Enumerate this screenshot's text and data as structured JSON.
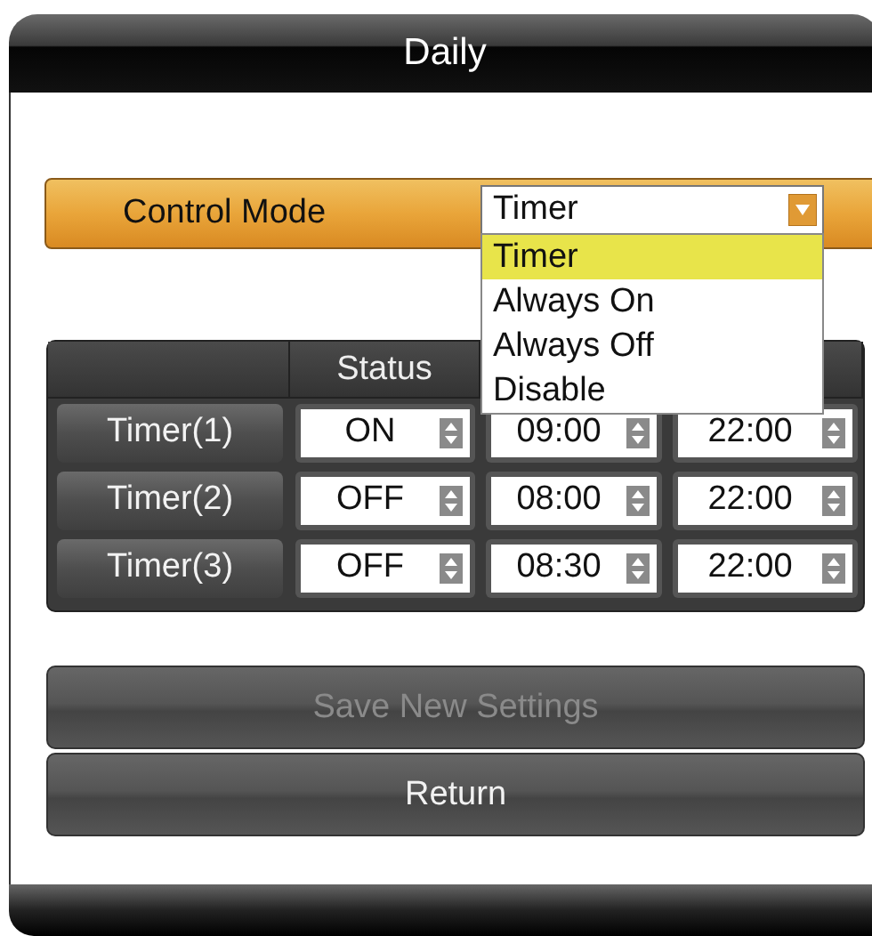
{
  "window": {
    "title": "Daily"
  },
  "control_mode": {
    "label": "Control Mode",
    "value": "Timer",
    "expanded": true,
    "options": [
      {
        "label": "Timer",
        "selected": true
      },
      {
        "label": "Always On",
        "selected": false
      },
      {
        "label": "Always Off",
        "selected": false
      },
      {
        "label": "Disable",
        "selected": false
      }
    ]
  },
  "table": {
    "columns": [
      "Status"
    ],
    "rows": [
      {
        "label": "Timer(1)",
        "status": "ON",
        "on_time": "09:00",
        "off_time": "22:00"
      },
      {
        "label": "Timer(2)",
        "status": "OFF",
        "on_time": "08:00",
        "off_time": "22:00"
      },
      {
        "label": "Timer(3)",
        "status": "OFF",
        "on_time": "08:30",
        "off_time": "22:00"
      }
    ]
  },
  "buttons": [
    {
      "label": "Save New Settings",
      "disabled": true
    },
    {
      "label": "Return",
      "disabled": false
    }
  ]
}
